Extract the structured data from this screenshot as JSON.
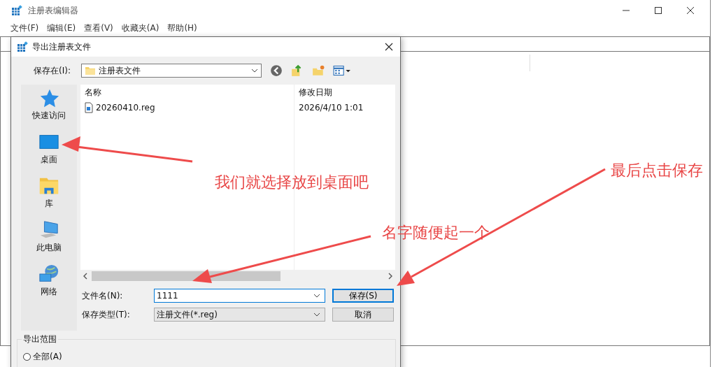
{
  "editor": {
    "title": "注册表编辑器",
    "menu": [
      "文件(F)",
      "编辑(E)",
      "查看(V)",
      "收藏夹(A)",
      "帮助(H)"
    ]
  },
  "dialog": {
    "title": "导出注册表文件",
    "save_in": {
      "label": "保存在(I):",
      "value": "注册表文件"
    },
    "places": [
      {
        "label": "快速访问",
        "kind": "star"
      },
      {
        "label": "桌面",
        "kind": "desktop"
      },
      {
        "label": "库",
        "kind": "library"
      },
      {
        "label": "此电脑",
        "kind": "computer"
      },
      {
        "label": "网络",
        "kind": "network"
      }
    ],
    "columns": [
      "名称",
      "修改日期"
    ],
    "files": [
      {
        "name": "20260410.reg",
        "date": "2026/4/10 1:01"
      }
    ],
    "file_name": {
      "label": "文件名(N):",
      "value": "1111"
    },
    "file_type": {
      "label": "保存类型(T):",
      "value": "注册文件(*.reg)"
    },
    "buttons": [
      "保存(S)",
      "取消"
    ],
    "range": {
      "title": "导出范围",
      "options": [
        {
          "label": "全部(A)",
          "selected": false
        }
      ]
    }
  },
  "annotations": [
    "我们就选择放到桌面吧",
    "名字随便起一个",
    "最后点击保存"
  ]
}
